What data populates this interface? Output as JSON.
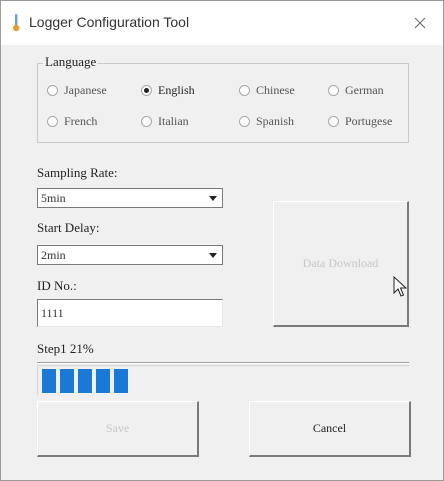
{
  "window": {
    "title": "Logger Configuration Tool",
    "close_glyph": "✕",
    "icon": "thermometer-icon"
  },
  "language_group": {
    "label": "Language",
    "options": [
      {
        "label": "Japanese",
        "checked": false
      },
      {
        "label": "English",
        "checked": true
      },
      {
        "label": "Chinese",
        "checked": false
      },
      {
        "label": "German",
        "checked": false
      },
      {
        "label": "French",
        "checked": false
      },
      {
        "label": "Italian",
        "checked": false
      },
      {
        "label": "Spanish",
        "checked": false
      },
      {
        "label": "Portugese",
        "checked": false
      }
    ]
  },
  "sampling_rate": {
    "label": "Sampling Rate:",
    "value": "5min"
  },
  "start_delay": {
    "label": "Start Delay:",
    "value": "2min"
  },
  "id_no": {
    "label": "ID No.:",
    "value": "1111"
  },
  "data_download": {
    "label": "Data Download",
    "enabled": false
  },
  "progress": {
    "label": "Step1 21%",
    "percent": 21,
    "blocks": 5,
    "color": "#1a79d6"
  },
  "buttons": {
    "save": "Save",
    "cancel": "Cancel"
  }
}
